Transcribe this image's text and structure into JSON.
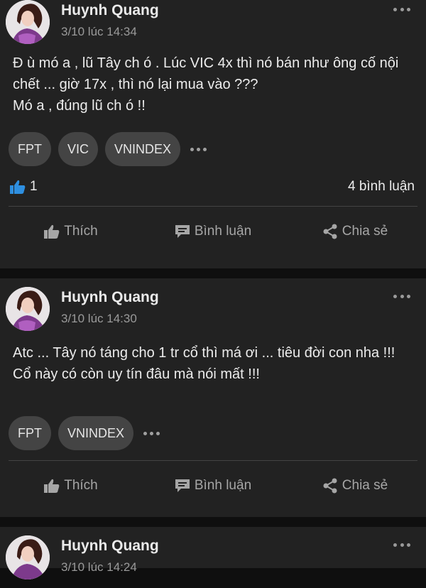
{
  "posts": [
    {
      "author": "Huynh Quang",
      "timestamp": "3/10 lúc 14:34",
      "content": "Đ ù mó a , lũ Tây ch ó . Lúc VIC 4x thì nó bán như ông cố nội chết ... giờ 17x , thì nó lại mua vào ???\nMó a , đúng lũ ch ó !!",
      "tags": [
        "FPT",
        "VIC",
        "VNINDEX"
      ],
      "likes": "1",
      "comments": "4 bình luận"
    },
    {
      "author": "Huynh Quang",
      "timestamp": "3/10 lúc 14:30",
      "content": "Atc ... Tây nó táng cho 1 tr cổ thì má ơi ... tiêu đời con nha !!!\nCổ này có còn uy tín đâu mà nói mất !!!",
      "tags": [
        "FPT",
        "VNINDEX"
      ]
    },
    {
      "author": "Huynh Quang",
      "timestamp": "3/10 lúc 14:24"
    }
  ],
  "actions": {
    "like": "Thích",
    "comment": "Bình luận",
    "share": "Chia sẻ"
  },
  "colors": {
    "background": "#0f0f0f",
    "card": "#222222",
    "tag": "#444444",
    "like_icon": "#2e8fe0"
  },
  "icons": [
    "more-icon",
    "thumbs-up-icon",
    "comment-icon",
    "share-icon"
  ]
}
